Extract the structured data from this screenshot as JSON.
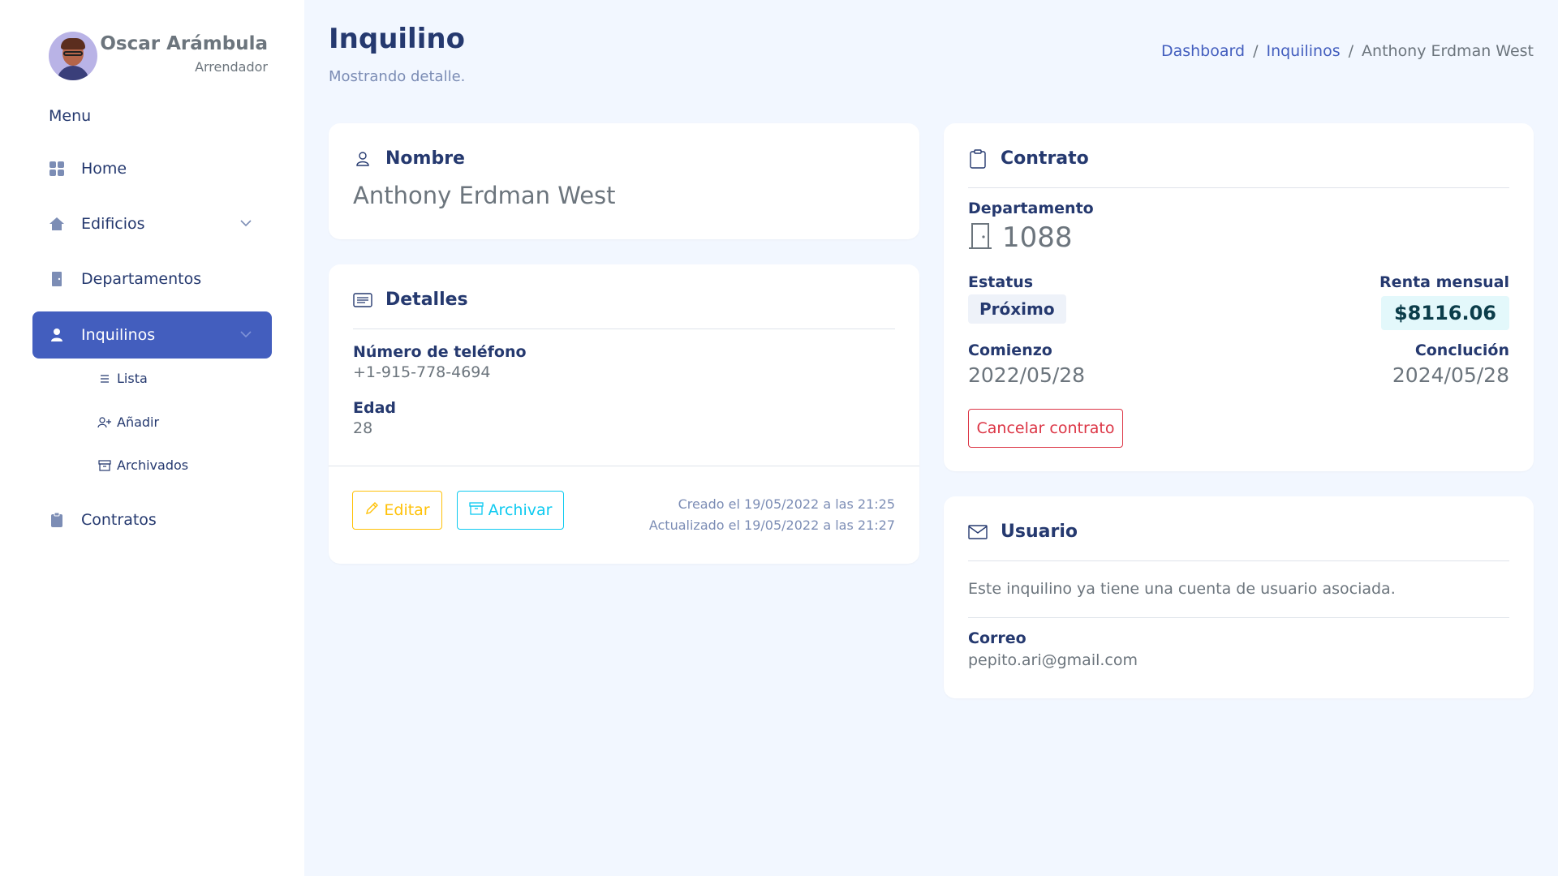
{
  "profile": {
    "name": "Oscar Arámbula",
    "role": "Arrendador"
  },
  "sidebar": {
    "menu_title": "Menu",
    "items": [
      {
        "label": "Home",
        "icon": "grid-icon"
      },
      {
        "label": "Edificios",
        "icon": "house-icon"
      },
      {
        "label": "Departamentos",
        "icon": "door-icon"
      },
      {
        "label": "Inquilinos",
        "icon": "person-icon",
        "active": true
      },
      {
        "label": "Contratos",
        "icon": "clipboard-icon"
      }
    ],
    "subitems": [
      {
        "label": "Lista",
        "icon": "list-icon"
      },
      {
        "label": "Añadir",
        "icon": "person-add-icon"
      },
      {
        "label": "Archivados",
        "icon": "archive-icon"
      }
    ]
  },
  "header": {
    "title": "Inquilino",
    "subtitle": "Mostrando detalle.",
    "breadcrumb": [
      "Dashboard",
      "Inquilinos",
      "Anthony Erdman West"
    ]
  },
  "nombre_card": {
    "title": "Nombre",
    "value": "Anthony Erdman West"
  },
  "detalles_card": {
    "title": "Detalles",
    "phone_label": "Número de teléfono",
    "phone_value": "+1-915-778-4694",
    "age_label": "Edad",
    "age_value": "28",
    "edit_button": "Editar",
    "archive_button": "Archivar",
    "created": "Creado el 19/05/2022 a las 21:25",
    "updated": "Actualizado el 19/05/2022 a las 21:27"
  },
  "contrato_card": {
    "title": "Contrato",
    "dept_label": "Departamento",
    "dept_value": "1088",
    "status_label": "Estatus",
    "status_value": "Próximo",
    "rent_label": "Renta mensual",
    "rent_value": "$8116.06",
    "start_label": "Comienzo",
    "start_value": "2022/05/28",
    "end_label": "Conclución",
    "end_value": "2024/05/28",
    "cancel_button": "Cancelar contrato"
  },
  "usuario_card": {
    "title": "Usuario",
    "message": "Este inquilino ya tiene una cuenta de usuario asociada.",
    "email_label": "Correo",
    "email_value": "pepito.ari@gmail.com"
  },
  "colors": {
    "primary": "#435ebe",
    "warning": "#ffc107",
    "info": "#0dcaf0",
    "danger": "#dc3545",
    "background": "#f2f7ff"
  }
}
